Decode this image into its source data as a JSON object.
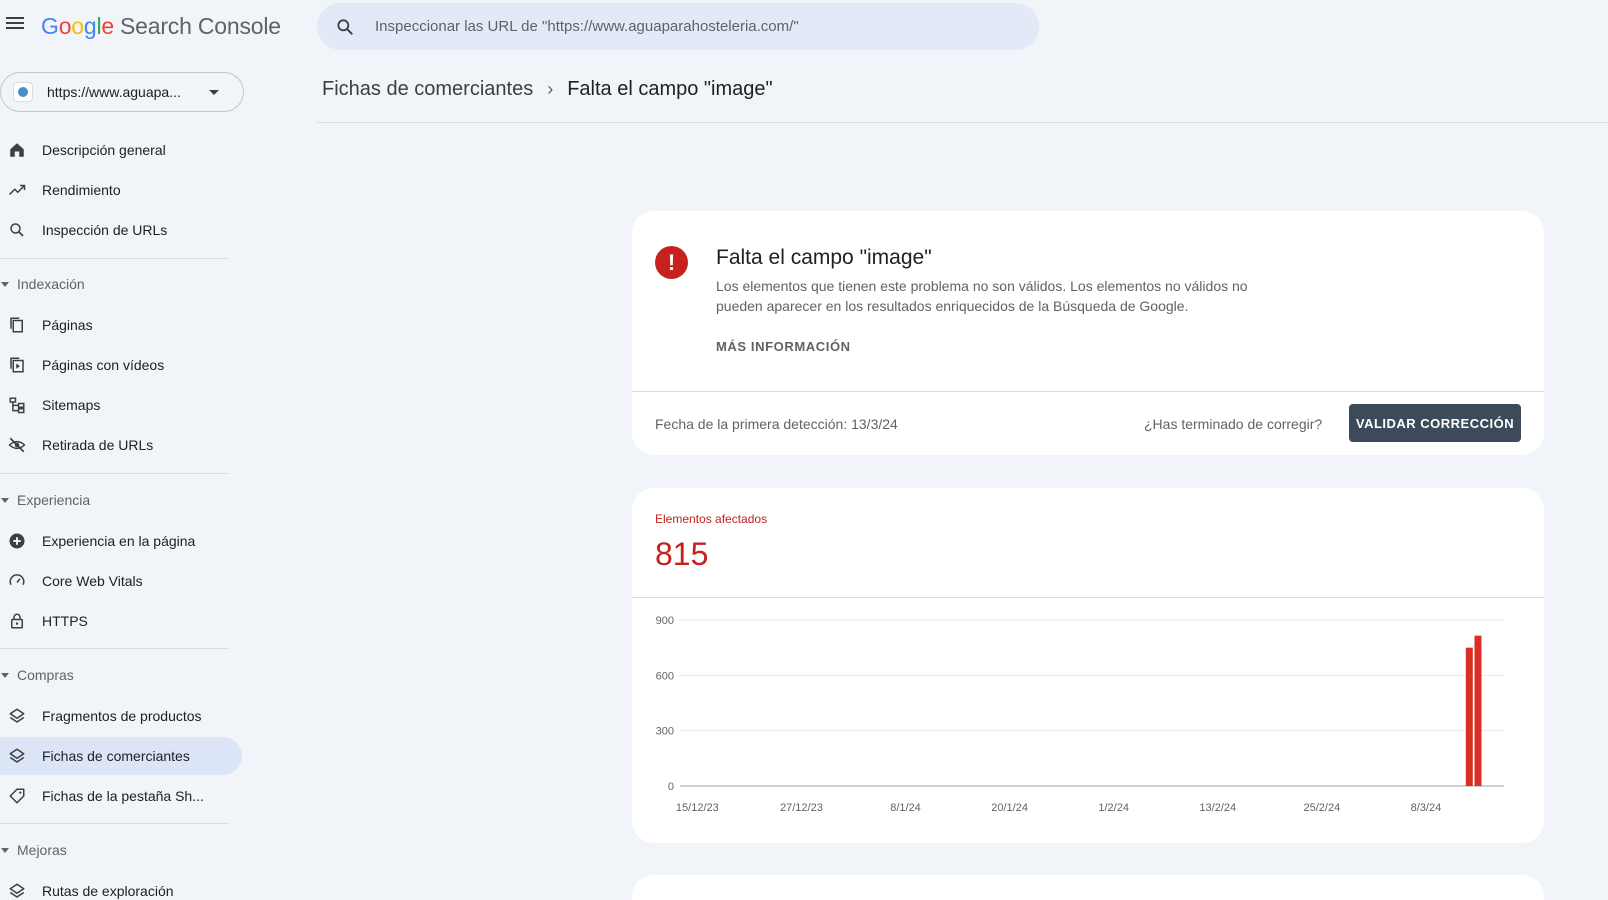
{
  "header": {
    "logo_letters": [
      "G",
      "o",
      "o",
      "g",
      "l",
      "e"
    ],
    "logo_rest": "Search Console",
    "search_placeholder": "Inspeccionar las URL de \"https://www.aguaparahosteleria.com/\""
  },
  "sidebar": {
    "property_label": "https://www.aguapa...",
    "items_top": [
      {
        "label": "Descripción general",
        "icon": "home-icon"
      },
      {
        "label": "Rendimiento",
        "icon": "trending-up-icon"
      },
      {
        "label": "Inspección de URLs",
        "icon": "search-icon"
      }
    ],
    "sections": [
      {
        "title": "Indexación",
        "items": [
          {
            "label": "Páginas",
            "icon": "pages-icon"
          },
          {
            "label": "Páginas con vídeos",
            "icon": "video-pages-icon"
          },
          {
            "label": "Sitemaps",
            "icon": "sitemap-icon"
          },
          {
            "label": "Retirada de URLs",
            "icon": "eye-off-icon"
          }
        ]
      },
      {
        "title": "Experiencia",
        "items": [
          {
            "label": "Experiencia en la página",
            "icon": "plus-circle-icon"
          },
          {
            "label": "Core Web Vitals",
            "icon": "gauge-icon"
          },
          {
            "label": "HTTPS",
            "icon": "lock-icon"
          }
        ]
      },
      {
        "title": "Compras",
        "items": [
          {
            "label": "Fragmentos de productos",
            "icon": "layers-icon"
          },
          {
            "label": "Fichas de comerciantes",
            "icon": "layers-icon",
            "active": true
          },
          {
            "label": "Fichas de la pestaña Sh...",
            "icon": "tag-icon"
          }
        ]
      },
      {
        "title": "Mejoras",
        "items": [
          {
            "label": "Rutas de exploración",
            "icon": "layers-icon"
          }
        ]
      }
    ]
  },
  "breadcrumb": {
    "parent": "Fichas de comerciantes",
    "current": "Falta el campo \"image\""
  },
  "issue": {
    "title": "Falta el campo \"image\"",
    "description": "Los elementos que tienen este problema no son válidos. Los elementos no válidos no pueden aparecer en los resultados enriquecidos de la Búsqueda de Google.",
    "more_info": "MÁS INFORMACIÓN",
    "first_detected": "Fecha de la primera detección: 13/3/24",
    "done_question": "¿Has terminado de corregir?",
    "validate_button": "VALIDAR CORRECCIÓN",
    "error_icon": "error-icon"
  },
  "affected": {
    "label": "Elementos afectados",
    "value": "815"
  },
  "colors": {
    "accent_error": "#c5221f",
    "bar": "#d93025",
    "active_nav": "#dbe5f7",
    "validate_button": "#3c4a5a"
  },
  "chart_data": {
    "type": "bar",
    "title": "",
    "xlabel": "",
    "ylabel": "",
    "ylim": [
      0,
      900
    ],
    "yticks": [
      0,
      300,
      600,
      900
    ],
    "x_tick_labels": [
      "15/12/23",
      "27/12/23",
      "8/1/24",
      "20/1/24",
      "1/2/24",
      "13/2/24",
      "25/2/24",
      "8/3/24"
    ],
    "x_range": [
      "2023-12-13",
      "2024-03-17"
    ],
    "series": [
      {
        "x": [
          "2024-03-13",
          "2024-03-14"
        ],
        "values": [
          750,
          815
        ]
      }
    ],
    "grid": true,
    "legend": "none"
  }
}
